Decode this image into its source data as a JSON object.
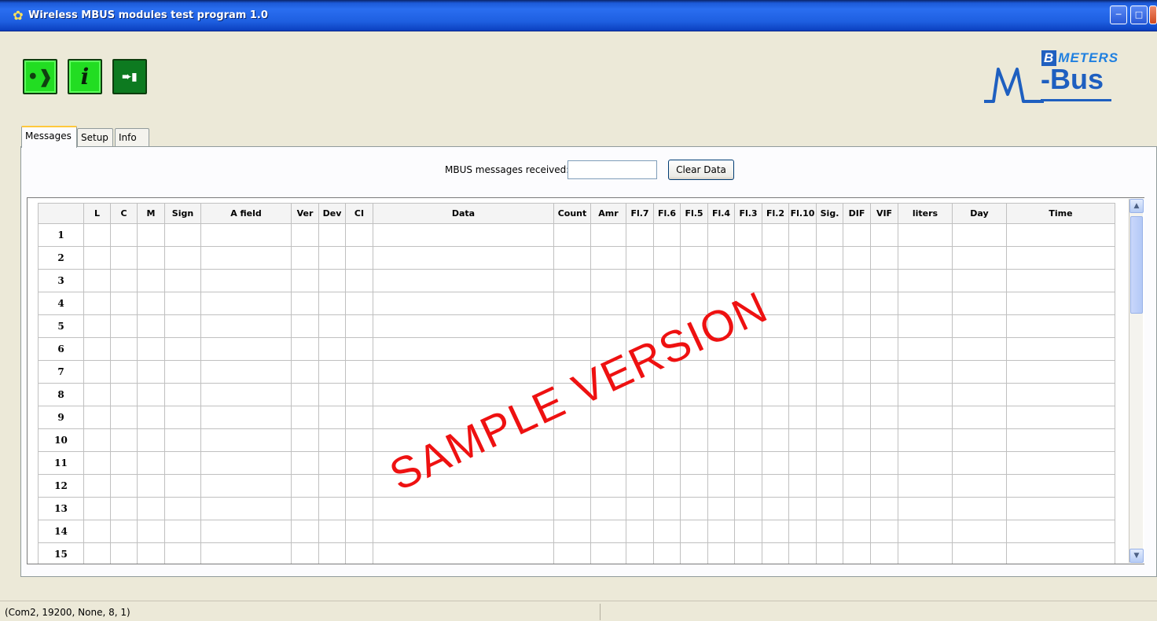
{
  "window": {
    "title": "Wireless MBUS modules test program 1.0",
    "controls": [
      "minimize",
      "maximize",
      "close"
    ]
  },
  "toolbar": {
    "buttons": [
      {
        "name": "speak",
        "icon": "speaking-head-icon"
      },
      {
        "name": "info",
        "icon": "info-icon",
        "glyph": "i"
      },
      {
        "name": "exit",
        "icon": "exit-door-icon"
      }
    ]
  },
  "logo": {
    "brand_letter": "B",
    "brand_word": "METERS",
    "product_m": "M",
    "product_rest": "-Bus"
  },
  "tabs": [
    {
      "label": "Messages",
      "active": true
    },
    {
      "label": "Setup",
      "active": false
    },
    {
      "label": "Info",
      "active": false
    }
  ],
  "messages": {
    "received_label": "MBUS messages received:",
    "received_value": "",
    "clear_button": "Clear Data"
  },
  "grid": {
    "columns": [
      "L",
      "C",
      "M",
      "Sign",
      "A field",
      "Ver",
      "Dev",
      "CI",
      "Data",
      "Count",
      "Amr",
      "Fl.7",
      "Fl.6",
      "Fl.5",
      "Fl.4",
      "Fl.3",
      "Fl.2",
      "Fl.10",
      "Sig.",
      "DIF",
      "VIF",
      "liters",
      "Day",
      "Time"
    ],
    "rows": [
      "1",
      "2",
      "3",
      "4",
      "5",
      "6",
      "7",
      "8",
      "9",
      "10",
      "11",
      "12",
      "13",
      "14",
      "15"
    ]
  },
  "watermark": "SAMPLE VERSION",
  "statusbar": {
    "text": "(Com2, 19200, None, 8, 1)"
  },
  "colors": {
    "titlebar": "#1e5fe0",
    "toolbar_green": "#22dd22",
    "exit_green": "#0d7a20",
    "logo_blue": "#1e5fc0",
    "watermark_red": "#ee1111",
    "tab_active_accent": "#ffc83c"
  }
}
